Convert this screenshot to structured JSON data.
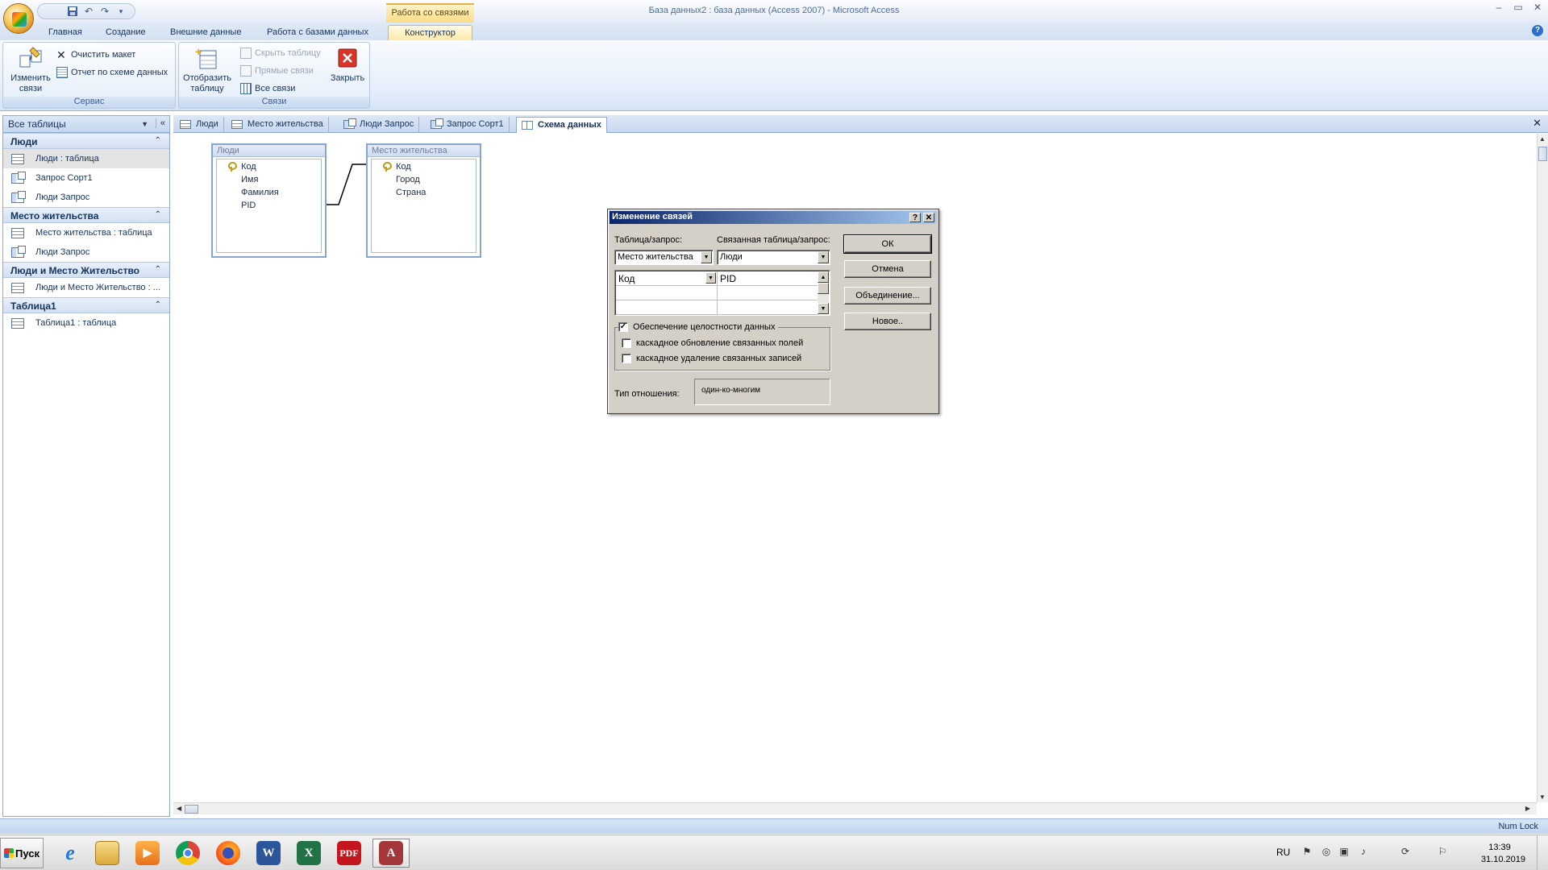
{
  "window": {
    "title": "База данных2 : база данных (Access 2007) - Microsoft Access",
    "context_header": "Работа со связями",
    "controls": [
      "–",
      "▭",
      "✕"
    ]
  },
  "ribbon": {
    "tabs": [
      "Главная",
      "Создание",
      "Внешние данные",
      "Работа с базами данных",
      "Конструктор"
    ],
    "active_tab": "Конструктор",
    "groups": {
      "service": {
        "label": "Сервис",
        "edit_relationships": "Изменить связи",
        "clear_layout": "Очистить макет",
        "report": "Отчет по схеме данных"
      },
      "relationships": {
        "label": "Связи",
        "show_table": "Отобразить таблицу",
        "hide_table": "Скрыть таблицу",
        "direct_relationships": "Прямые связи",
        "all_relationships": "Все связи",
        "close": "Закрыть"
      }
    }
  },
  "nav": {
    "header": "Все таблицы",
    "groups": [
      {
        "name": "Люди",
        "items": [
          {
            "label": "Люди : таблица",
            "icon": "table-icon"
          },
          {
            "label": "Запрос Сорт1",
            "icon": "query-icon"
          },
          {
            "label": "Люди Запрос",
            "icon": "query-icon"
          }
        ]
      },
      {
        "name": "Место жительства",
        "items": [
          {
            "label": "Место жительства : таблица",
            "icon": "table-icon"
          },
          {
            "label": "Люди Запрос",
            "icon": "query-icon"
          }
        ]
      },
      {
        "name": "Люди и Место Жительство",
        "items": [
          {
            "label": "Люди и Место Жительство : ...",
            "icon": "table-icon"
          }
        ]
      },
      {
        "name": "Таблица1",
        "items": [
          {
            "label": "Таблица1 : таблица",
            "icon": "table-icon"
          }
        ]
      }
    ]
  },
  "doc_tabs": [
    "Люди",
    "Место жительства",
    "Люди Запрос",
    "Запрос Сорт1",
    "Схема данных"
  ],
  "active_doc_tab": "Схема данных",
  "tables": {
    "people": {
      "title": "Люди",
      "fields": [
        "Код",
        "Имя",
        "Фамилия",
        "PID"
      ]
    },
    "residence": {
      "title": "Место жительства",
      "fields": [
        "Код",
        "Город",
        "Страна"
      ]
    }
  },
  "dialog": {
    "title": "Изменение связей",
    "help": "?",
    "close": "✕",
    "table_label": "Таблица/запрос:",
    "related_label": "Связанная таблица/запрос:",
    "table_value": "Место жительства",
    "related_value": "Люди",
    "grid_rows": [
      [
        "Код",
        "PID"
      ],
      [
        "",
        ""
      ],
      [
        "",
        ""
      ]
    ],
    "ok": "ОК",
    "cancel": "Отмена",
    "join": "Объединение...",
    "new": "Новое..",
    "integrity": {
      "label": "Обеспечение целостности данных",
      "checked": true
    },
    "cascade_update": {
      "label": "каскадное обновление связанных полей",
      "checked": false
    },
    "cascade_delete": {
      "label": "каскадное удаление связанных записей",
      "checked": false
    },
    "relation_type_label": "Тип отношения:",
    "relation_type_value": "один-ко-многим"
  },
  "status": {
    "numlock": "Num Lock"
  },
  "taskbar": {
    "start": "Пуск",
    "apps": [
      "ie-icon",
      "explorer-icon",
      "media-player-icon",
      "chrome-icon",
      "firefox-icon",
      "word-icon",
      "excel-icon",
      "acrobat-icon",
      "access-icon"
    ],
    "lang": "RU",
    "time": "13:39",
    "date": "31.10.2019"
  }
}
